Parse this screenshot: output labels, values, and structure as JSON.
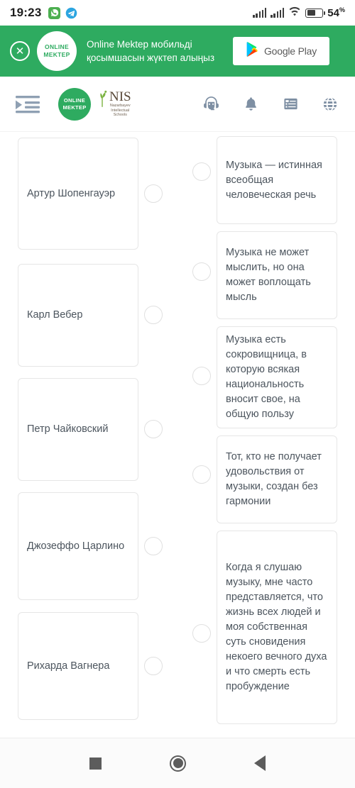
{
  "status_bar": {
    "time": "19:23",
    "icons": [
      "whatsapp-icon",
      "telegram-icon"
    ],
    "signal": "signal-bars-icon",
    "wifi": "wifi-icon",
    "battery_percent": "54",
    "battery_percent_symbol": "%"
  },
  "promo_banner": {
    "close_label": "✕",
    "logo_line1": "ONLINE",
    "logo_line2": "MEKTEP",
    "text": "Online Mektep мобильді қосымшасын жүктеп алыңыз",
    "store_button_label": "Google Play",
    "background_color": "#2eab60"
  },
  "navbar": {
    "menu_icon": "indent-menu-icon",
    "brand_logo_line1": "ONLINE",
    "brand_logo_line2": "MEKTEP",
    "nis_title": "NIS",
    "nis_sub_line1": "Nazarbayev",
    "nis_sub_line2": "Intellectual",
    "nis_sub_line3": "Schools",
    "actions": [
      {
        "name": "support-icon",
        "label": "support"
      },
      {
        "name": "bell-icon",
        "label": "notifications"
      },
      {
        "name": "list-icon",
        "label": "list"
      },
      {
        "name": "globe-icon",
        "label": "language"
      }
    ]
  },
  "matching_task": {
    "left_items": [
      {
        "text": "Артур Шопенгауэр"
      },
      {
        "text": "Карл Вебер"
      },
      {
        "text": "Петр Чайковский"
      },
      {
        "text": "Джозеффо Царлино"
      },
      {
        "text": "Рихарда Вагнера"
      }
    ],
    "right_items": [
      {
        "text": "Музыка — истинная всеобщая человеческая речь"
      },
      {
        "text": "Музыка не может мыслить, но она может воплощать мысль"
      },
      {
        "text": "Музыка есть сокровищница, в которую всякая национальность вносит свое, на общую пользу"
      },
      {
        "text": "Тот, кто не получает удовольствия от музыки, создан без гармонии"
      },
      {
        "text": "Когда я слушаю музыку, мне часто представляется, что жизнь всех людей и моя собственная суть сновидения некоего вечного духа и что смерть есть пробуждение"
      }
    ]
  },
  "android_nav": {
    "recents": "square-recents-icon",
    "home": "circle-home-icon",
    "back": "triangle-back-icon"
  }
}
